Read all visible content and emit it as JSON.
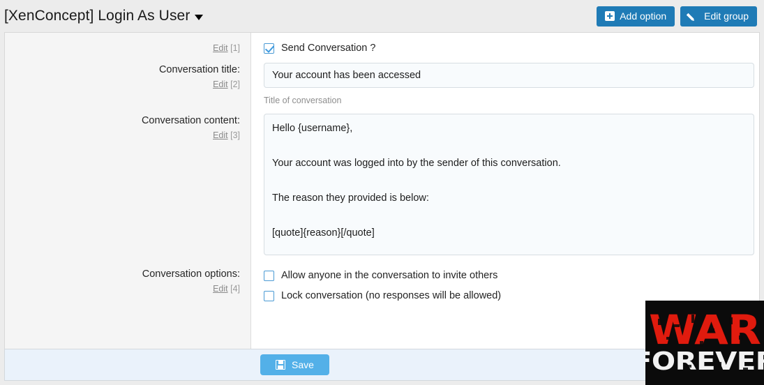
{
  "header": {
    "title": "[XenConcept] Login As User",
    "dropdown_icon": "caret-down-icon",
    "buttons": [
      {
        "label": "Add option",
        "icon": "plus-square-icon"
      },
      {
        "label": "Edit group",
        "icon": "pencil-icon"
      }
    ],
    "accent_color": "#1f7bb6"
  },
  "form": {
    "rows": [
      {
        "label": "",
        "edit_label": "Edit",
        "edit_index": "[1]",
        "type": "checkbox",
        "checkbox_label": "Send Conversation ?",
        "checked": true
      },
      {
        "label": "Conversation title:",
        "edit_label": "Edit",
        "edit_index": "[2]",
        "type": "text",
        "value": "Your account has been accessed",
        "placeholder": "",
        "hint": "Title of conversation"
      },
      {
        "label": "Conversation content:",
        "edit_label": "Edit",
        "edit_index": "[3]",
        "type": "textarea",
        "value": "Hello {username},\n\nYour account was logged into by the sender of this conversation.\n\nThe reason they provided is below:\n\n[quote]{reason}[/quote]\n\nThis was an automated message. Reply only if necessary."
      },
      {
        "label": "Conversation options:",
        "edit_label": "Edit",
        "edit_index": "[4]",
        "type": "checkbox-group",
        "options": [
          {
            "label": "Allow anyone in the conversation to invite others",
            "checked": false
          },
          {
            "label": "Lock conversation (no responses will be allowed)",
            "checked": false
          }
        ]
      }
    ]
  },
  "footer": {
    "save_label": "Save",
    "save_icon": "floppy-disk-icon",
    "save_color": "#53b0e8"
  },
  "watermark": {
    "line1": "WAR",
    "line2": "FOREVER",
    "line1_color": "#e01b0e",
    "line2_color": "#f2f2f2",
    "background": "#0b0b0b"
  }
}
